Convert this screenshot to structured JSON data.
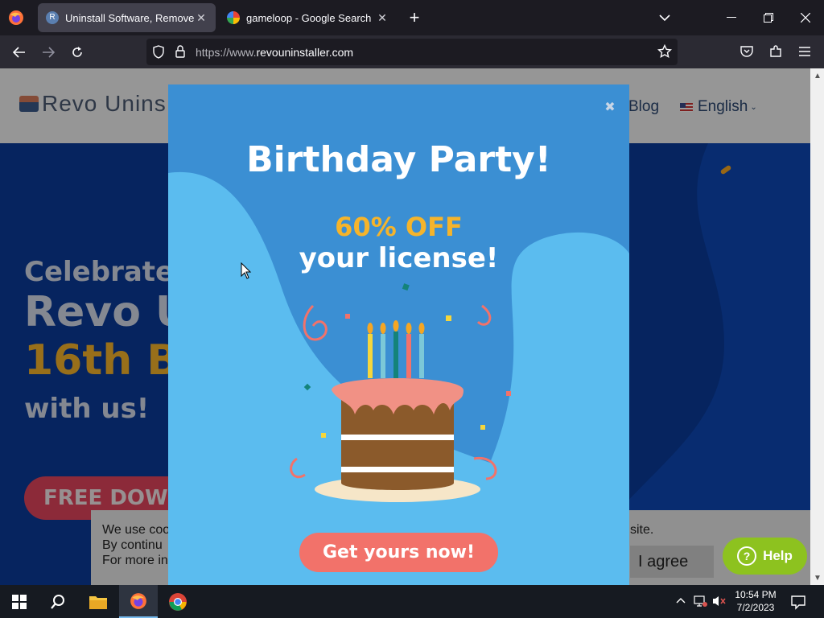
{
  "browser": {
    "tabs": [
      {
        "title": "Uninstall Software, Remove pro",
        "active": true
      },
      {
        "title": "gameloop - Google Search",
        "active": false
      }
    ],
    "new_tab_symbol": "+",
    "url_prefix": "https://www.",
    "url_domain": "revouninstaller.com",
    "icons": [
      "firefox-icon",
      "back-icon",
      "forward-icon",
      "reload-icon",
      "shield-icon",
      "lock-icon",
      "bookmark-star-icon",
      "pocket-icon",
      "extensions-icon",
      "menu-icon",
      "tab-list-icon",
      "minimize-icon",
      "maximize-icon",
      "close-icon"
    ]
  },
  "site": {
    "logo_text": "Revo Unins",
    "nav_blog": "Blog",
    "nav_language": "English",
    "hero_lines": [
      "Celebrate",
      "Revo U",
      "16th B",
      "with us!"
    ],
    "hero_button": "FREE DOW",
    "cookie_lines": [
      "We use coo",
      "By continu",
      "For more in"
    ],
    "cookie_suffix": "site.",
    "agree_button": "I agree",
    "help_button": "Help"
  },
  "popup": {
    "title": "Birthday Party!",
    "discount": "60% OFF",
    "subtitle": "your license!",
    "cta": "Get yours now!",
    "close_symbol": "✖"
  },
  "taskbar": {
    "time": "10:54 PM",
    "date": "7/2/2023",
    "icons": [
      "windows-start-icon",
      "search-icon",
      "file-explorer-icon",
      "firefox-icon",
      "chrome-icon",
      "show-hidden-icons-icon",
      "network-icon",
      "volume-muted-icon",
      "notification-icon"
    ]
  },
  "colors": {
    "popup_bg": "#3b8fd3",
    "popup_accent": "#5bbcef",
    "discount": "#f5b42b",
    "cta": "#f2726a",
    "hero_yellow": "#f5b42b",
    "help_green": "#8dc21f"
  }
}
